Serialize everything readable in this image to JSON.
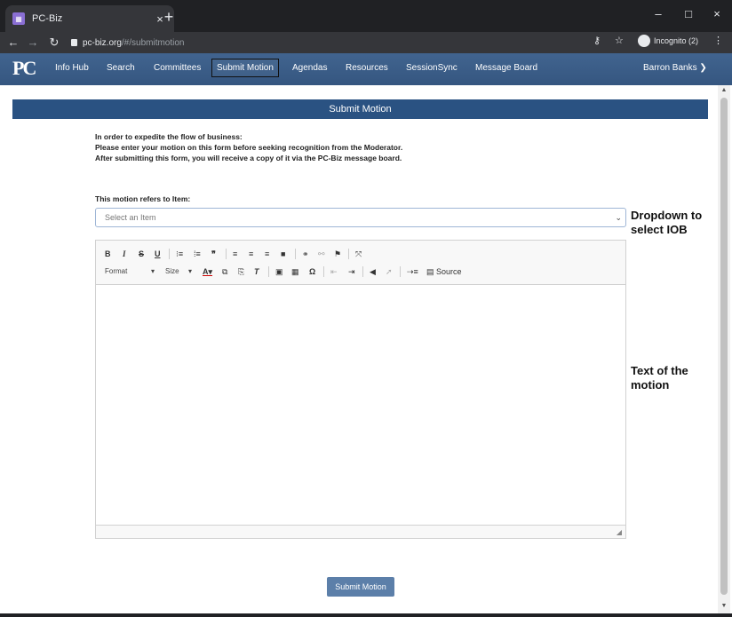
{
  "browser": {
    "tab_title": "PC-Biz",
    "tab_close": "×",
    "new_tab": "+",
    "url_host": "pc-biz.org",
    "url_path": "/#/submitmotion",
    "incognito_label": "Incognito (2)",
    "minimize": "–",
    "maximize": "□",
    "close": "×"
  },
  "site": {
    "logo_text": "PC",
    "nav": [
      "Info Hub",
      "Search",
      "Committees",
      "Submit Motion",
      "Agendas",
      "Resources",
      "SessionSync",
      "Message Board"
    ],
    "active_nav": "Submit Motion",
    "user": "Barron Banks ❯"
  },
  "main": {
    "banner": "Submit Motion",
    "intro_1": "In order to expedite the flow of business:",
    "intro_2": "Please enter your motion on this form before seeking recognition from the Moderator.",
    "intro_3": "After submitting this form, you will receive a copy of it via the PC-Biz message board.",
    "refers_label": "This motion refers to Item:",
    "select_placeholder": "Select an Item",
    "submit_label": "Submit Motion"
  },
  "editor": {
    "format_label": "Format",
    "size_label": "Size",
    "source_label": "Source"
  },
  "annotations": {
    "dropdown_1": "Dropdown to",
    "dropdown_2": "select IOB",
    "text_1": "Text of the",
    "text_2": "motion"
  }
}
